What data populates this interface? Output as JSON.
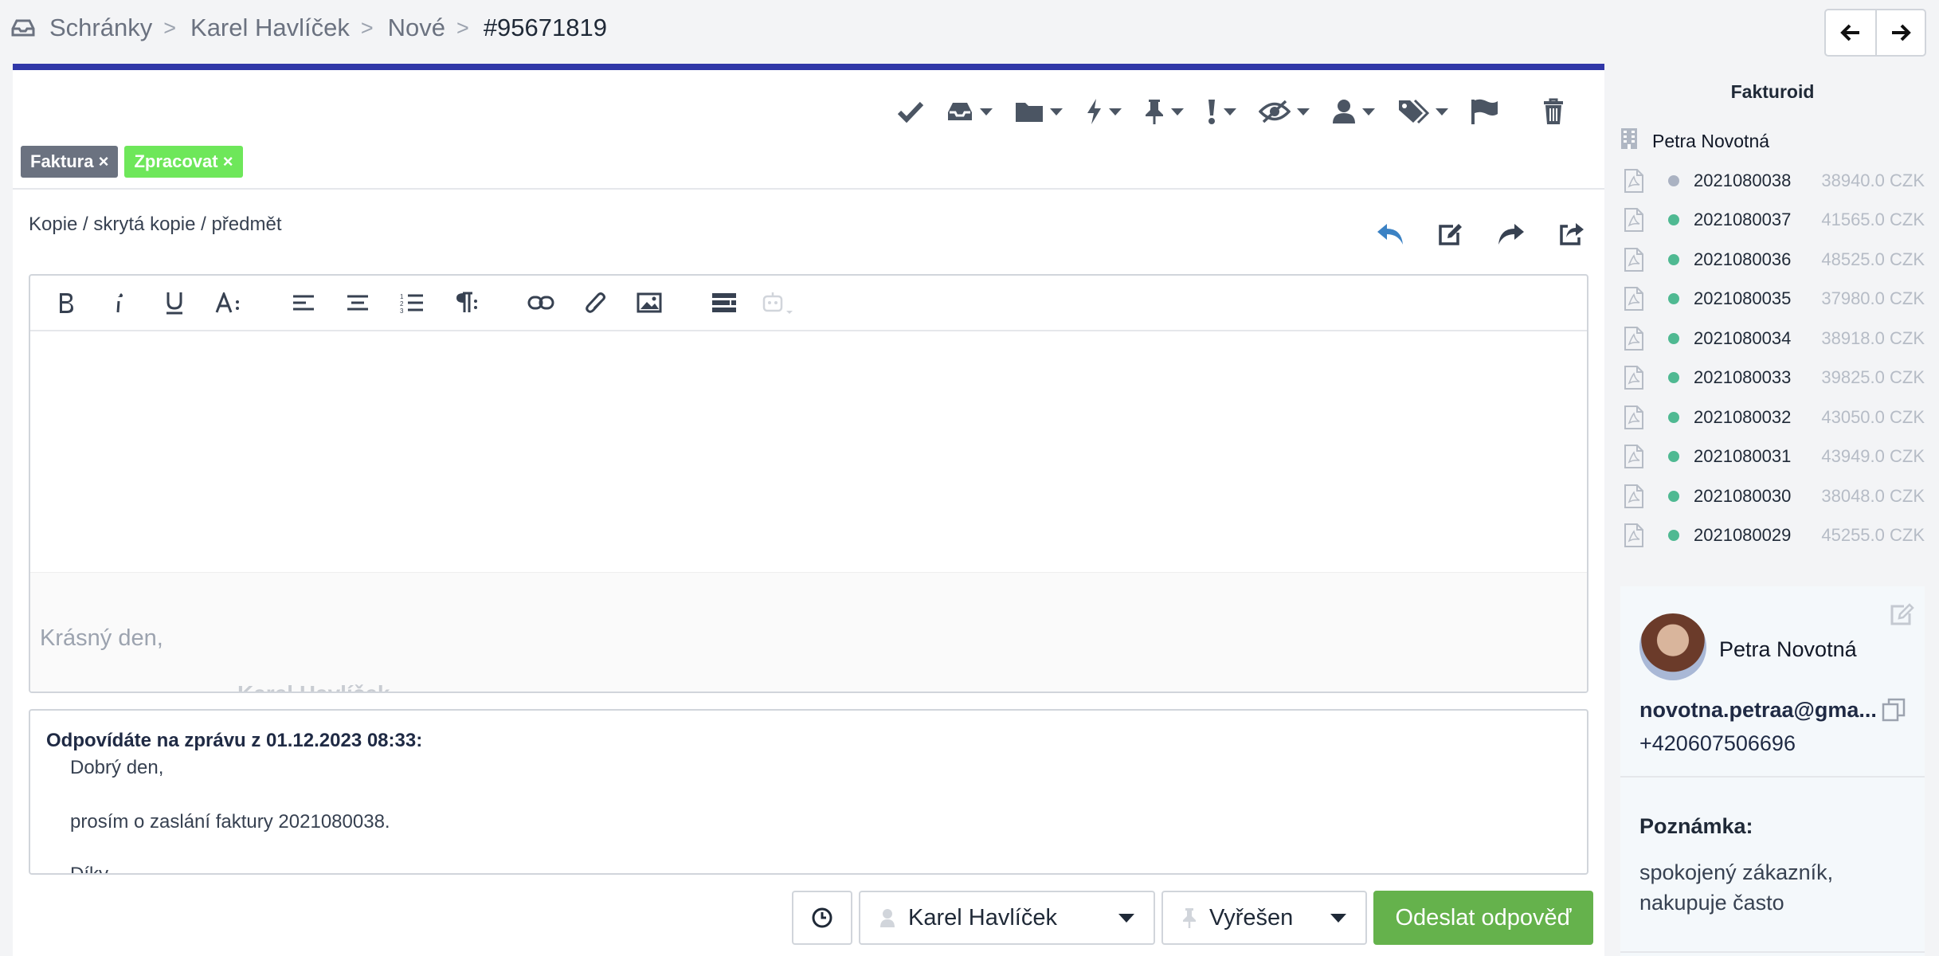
{
  "breadcrumb": {
    "items": [
      "Schránky",
      "Karel Havlíček",
      "Nové"
    ],
    "separator": ">",
    "current": "#95671819"
  },
  "toolbar": {
    "icons": [
      "check-icon",
      "inbox-icon",
      "folder-icon",
      "bolt-icon",
      "pin-icon",
      "exclamation-icon",
      "eye-slash-icon",
      "user-icon",
      "tags-icon",
      "flag-icon",
      "trash-icon"
    ]
  },
  "tags": [
    {
      "label": "Faktura ×",
      "color": "#6b7280"
    },
    {
      "label": "Zpracovat ×",
      "color": "#6ee75a"
    }
  ],
  "compose": {
    "cc_link": "Kopie / skrytá kopie / předmět",
    "signature_greeting": "Krásný den,",
    "signature_name": "Karel Havlíček"
  },
  "quoted": {
    "header": "Odpovídáte na zprávu z 01.12.2023 08:33:",
    "lines": [
      "Dobrý den,",
      "prosím o zaslání faktury 2021080038.",
      "Díky"
    ]
  },
  "actions": {
    "assignee": "Karel Havlíček",
    "status": "Vyřešen",
    "send_label": "Odeslat odpověď",
    "send_color": "#65b24c"
  },
  "sidebar": {
    "title": "Fakturoid",
    "customer": "Petra Novotná",
    "invoices": [
      {
        "number": "2021080038",
        "amount": "38940.0 CZK",
        "status": "unpaid"
      },
      {
        "number": "2021080037",
        "amount": "41565.0 CZK",
        "status": "paid"
      },
      {
        "number": "2021080036",
        "amount": "48525.0 CZK",
        "status": "paid"
      },
      {
        "number": "2021080035",
        "amount": "37980.0 CZK",
        "status": "paid"
      },
      {
        "number": "2021080034",
        "amount": "38918.0 CZK",
        "status": "paid"
      },
      {
        "number": "2021080033",
        "amount": "39825.0 CZK",
        "status": "paid"
      },
      {
        "number": "2021080032",
        "amount": "43050.0 CZK",
        "status": "paid"
      },
      {
        "number": "2021080031",
        "amount": "43949.0 CZK",
        "status": "paid"
      },
      {
        "number": "2021080030",
        "amount": "38048.0 CZK",
        "status": "paid"
      },
      {
        "number": "2021080029",
        "amount": "45255.0 CZK",
        "status": "paid"
      }
    ],
    "status_colors": {
      "paid": "#4fb992",
      "unpaid": "#aab2c2"
    }
  },
  "contact": {
    "name": "Petra Novotná",
    "email": "novotna.petraa@gma...",
    "phone": "+420607506696",
    "note_label": "Poznámka:",
    "note_text": "spokojený zákazník, nakupuje často"
  }
}
